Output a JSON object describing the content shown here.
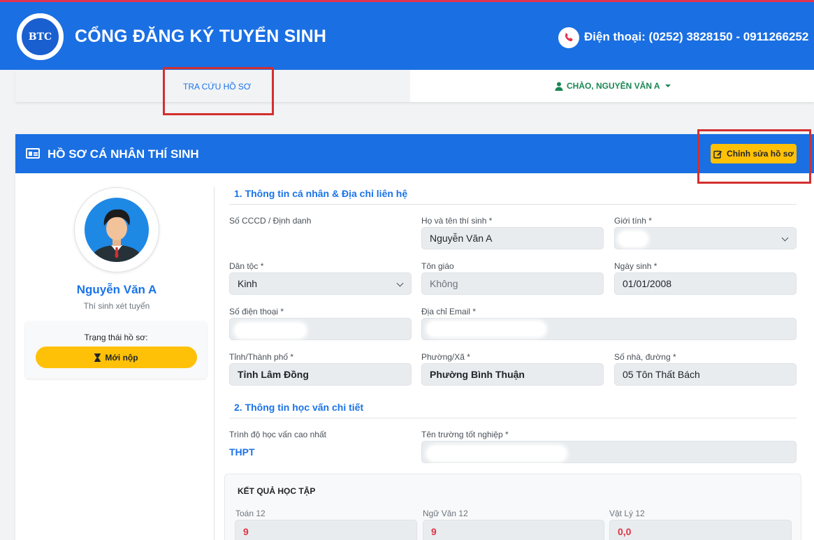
{
  "header": {
    "logo_text": "BTC",
    "title": "CỔNG ĐĂNG KÝ TUYỂN SINH",
    "phone": "Điện thoại: (0252) 3828150 - 0911266252"
  },
  "nav": {
    "lookup": "TRA CỨU HỒ SƠ",
    "user": "CHÀO, NGUYỄN VĂN A"
  },
  "card": {
    "title": "HỒ SƠ CÁ NHÂN THÍ SINH",
    "edit_button": "Chỉnh sửa hồ sơ"
  },
  "profile": {
    "name": "Nguyễn Văn A",
    "role": "Thí sinh xét tuyển",
    "status_label": "Trạng thái hồ sơ:",
    "status_value": "Mới nộp"
  },
  "section1": {
    "title": "1. Thông tin cá nhân & Địa chỉ liên hệ",
    "id_label": "Số CCCD / Định danh",
    "fullname_label": "Họ và tên thí sinh *",
    "fullname_value": "Nguyễn Văn A",
    "gender_label": "Giới tính *",
    "ethnic_label": "Dân tộc *",
    "ethnic_value": "Kinh",
    "religion_label": "Tôn giáo",
    "religion_value": "Không",
    "dob_label": "Ngày sinh *",
    "dob_value": "01/01/2008",
    "phone_label": "Số điện thoại *",
    "email_label": "Địa chỉ Email *",
    "province_label": "Tỉnh/Thành phố *",
    "province_value": "Tỉnh Lâm Đồng",
    "ward_label": "Phường/Xã *",
    "ward_value": "Phường Bình Thuận",
    "street_label": "Số nhà, đường *",
    "street_value": "05 Tôn Thất Bách"
  },
  "section2": {
    "title": "2. Thông tin học vấn chi tiết",
    "level_label": "Trình độ học vấn cao nhất",
    "level_value": "THPT",
    "school_label": "Tên trường tốt nghiệp *"
  },
  "results": {
    "title": "KẾT QUẢ HỌC TẬP",
    "scores": [
      {
        "label": "Toán 12",
        "value": "9"
      },
      {
        "label": "Ngữ Văn 12",
        "value": "9"
      },
      {
        "label": "Vật Lý 12",
        "value": "0,0"
      }
    ]
  },
  "colors": {
    "primary": "#1a6fe3",
    "accent_yellow": "#ffc107",
    "highlight_red": "#d32f2f",
    "success_green": "#198754",
    "score_red": "#dc3545"
  }
}
